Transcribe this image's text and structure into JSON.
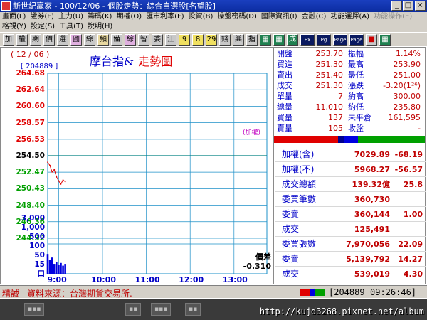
{
  "window": {
    "title": "新世紀贏家 - 100/12/06 - 個股走勢：綜合自選股[名望股]",
    "controls": [
      "_",
      "□",
      "×"
    ]
  },
  "menus": {
    "row1": [
      "畫面(L)",
      "證券(F)",
      "主力(U)",
      "籌碼(K)",
      "期權(O)",
      "匯市利率(F)",
      "投資(B)",
      "操盤密碼(D)",
      "國際資訊(I)",
      "金融(C)",
      "功能選擇(A)",
      "功能操作(E)"
    ],
    "row2": [
      "格視(Y)",
      "設定(S)",
      "工具(T)",
      "說明(H)"
    ]
  },
  "toolbar": {
    "buttons": [
      "加",
      "權",
      "期",
      "價",
      "選",
      "圓",
      "綜",
      "頻",
      "備",
      "綜",
      "智",
      "委",
      "江",
      "9",
      "8",
      "29",
      "錢",
      "興",
      "指",
      "▦",
      "▦",
      "成",
      "Ex",
      "Pg",
      "Page",
      "Page",
      "■",
      "▦"
    ]
  },
  "chart": {
    "date": "( 12 / 06 )",
    "code_box": "[ 204889 ]",
    "title_main": "摩台指&",
    "title_sub": "走勢圖",
    "ref_label": "(加權)",
    "y_labels": [
      "264.68",
      "262.64",
      "260.60",
      "258.57",
      "256.53",
      "254.50",
      "252.47",
      "250.43",
      "248.40",
      "246.36",
      "244.32"
    ],
    "vol_labels": [
      "3,000",
      "1,000",
      "500",
      "100",
      "50",
      "15",
      "口"
    ],
    "x_labels": [
      "9:00",
      "10:00",
      "11:00",
      "12:00",
      "13:00"
    ],
    "diff_label": "價差",
    "diff_value": "-0.310",
    "colors": {
      "up": "#e00000",
      "down": "#00a000",
      "flat": "#000000",
      "grid": "#1e90c8",
      "price_line": "#e00000",
      "volume": "#0000e0",
      "ref_line": "#008080"
    }
  },
  "chart_data": {
    "type": "line",
    "title": "摩台指& 走勢圖",
    "xlabel": "",
    "ylabel": "",
    "x_ticks": [
      "9:00",
      "10:00",
      "11:00",
      "12:00",
      "13:00"
    ],
    "ylim": [
      244.32,
      264.68
    ],
    "reference_price": 254.5,
    "series": [
      {
        "name": "",
        "x": [
          "8:45",
          "8:48",
          "8:51",
          "8:54",
          "8:57",
          "9:00",
          "9:03",
          "9:06",
          "9:09"
        ],
        "values": [
          253.7,
          253.3,
          252.5,
          252.8,
          251.9,
          251.4,
          251.0,
          251.5,
          251.3
        ]
      }
    ],
    "volume": {
      "x": [
        "8:45",
        "8:48",
        "8:51",
        "8:54",
        "8:57",
        "9:00",
        "9:03",
        "9:06",
        "9:09"
      ],
      "values": [
        2200,
        1500,
        1800,
        1100,
        1300,
        1000,
        1200,
        900,
        1100
      ]
    }
  },
  "quote": {
    "rows": [
      {
        "l1": "開盤",
        "v1": "253.70",
        "l2": "振幅",
        "v2": "1.14%"
      },
      {
        "l1": "買進",
        "v1": "251.30",
        "l2": "最高",
        "v2": "253.90"
      },
      {
        "l1": "賣出",
        "v1": "251.40",
        "l2": "最低",
        "v2": "251.00"
      },
      {
        "l1": "成交",
        "v1": "251.30",
        "l2": "漲跌",
        "v2": "-3.20(1²⁶)"
      },
      {
        "l1": "單量",
        "v1": "7",
        "l2": "約高",
        "v2": "300.00"
      },
      {
        "l1": "總量",
        "v1": "11,010",
        "l2": "約低",
        "v2": "235.80"
      },
      {
        "l1": "買量",
        "v1": "137",
        "l2": "未平倉",
        "v2": "161,595"
      },
      {
        "l1": "賣量",
        "v1": "105",
        "l2": "收盤",
        "v2": "-"
      }
    ],
    "index": [
      {
        "label": "加權(含)",
        "v1": "7029.89",
        "v2": "-68.19"
      },
      {
        "label": "加權(不)",
        "v1": "5968.27",
        "v2": "-56.57"
      },
      {
        "label": "成交總額",
        "v1": "139.32億",
        "v2": "25.8"
      },
      {
        "label": "委買筆數",
        "v1": "360,730",
        "v2": ""
      },
      {
        "label": "委賣",
        "v1": "360,144",
        "v2": "1.00"
      },
      {
        "label": "成交",
        "v1": "125,491",
        "v2": ""
      },
      {
        "label": "委買張數",
        "v1": "7,970,056",
        "v2": "22.09"
      },
      {
        "label": "委賣",
        "v1": "5,139,792",
        "v2": "14.27"
      },
      {
        "label": "成交",
        "v1": "539,019",
        "v2": "4.30"
      }
    ]
  },
  "status": {
    "label": "精誠",
    "source": "資料來源：台灣期貨交易所.",
    "code": "[204889",
    "time": "09:26:46]"
  },
  "taskbar": {
    "url": "http://kujd3268.pixnet.net/album"
  }
}
